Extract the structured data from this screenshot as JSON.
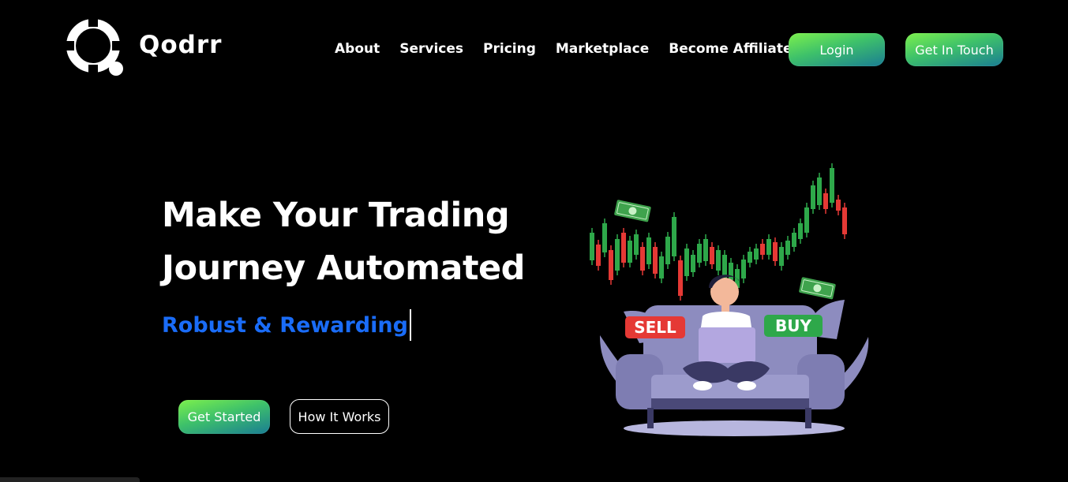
{
  "brand": {
    "name": "Qodrr"
  },
  "nav": {
    "items": [
      {
        "label": "About"
      },
      {
        "label": "Services"
      },
      {
        "label": "Pricing"
      },
      {
        "label": "Marketplace"
      },
      {
        "label": "Become Affiliate"
      }
    ],
    "login_label": "Login",
    "contact_label": "Get In Touch"
  },
  "hero": {
    "headline_line1": "Make Your Trading",
    "headline_line2": "Journey Automated",
    "subheadline": "Robust & Rewarding",
    "cta_primary": "Get Started",
    "cta_secondary": "How It Works"
  },
  "illustration": {
    "sell_label": "SELL",
    "buy_label": "BUY"
  },
  "colors": {
    "background": "#000000",
    "accent_blue": "#1a6cf7",
    "gradient_start": "#7cf04c",
    "gradient_end": "#1a7d93",
    "sell_red": "#e53935",
    "buy_green": "#2ea84a",
    "candle_green": "#2ea84a",
    "candle_red": "#e53935",
    "sofa": "#8d8cbf"
  },
  "icons": {
    "logo": "qodrr-logo-icon",
    "money": "dollar-bill-icon"
  }
}
